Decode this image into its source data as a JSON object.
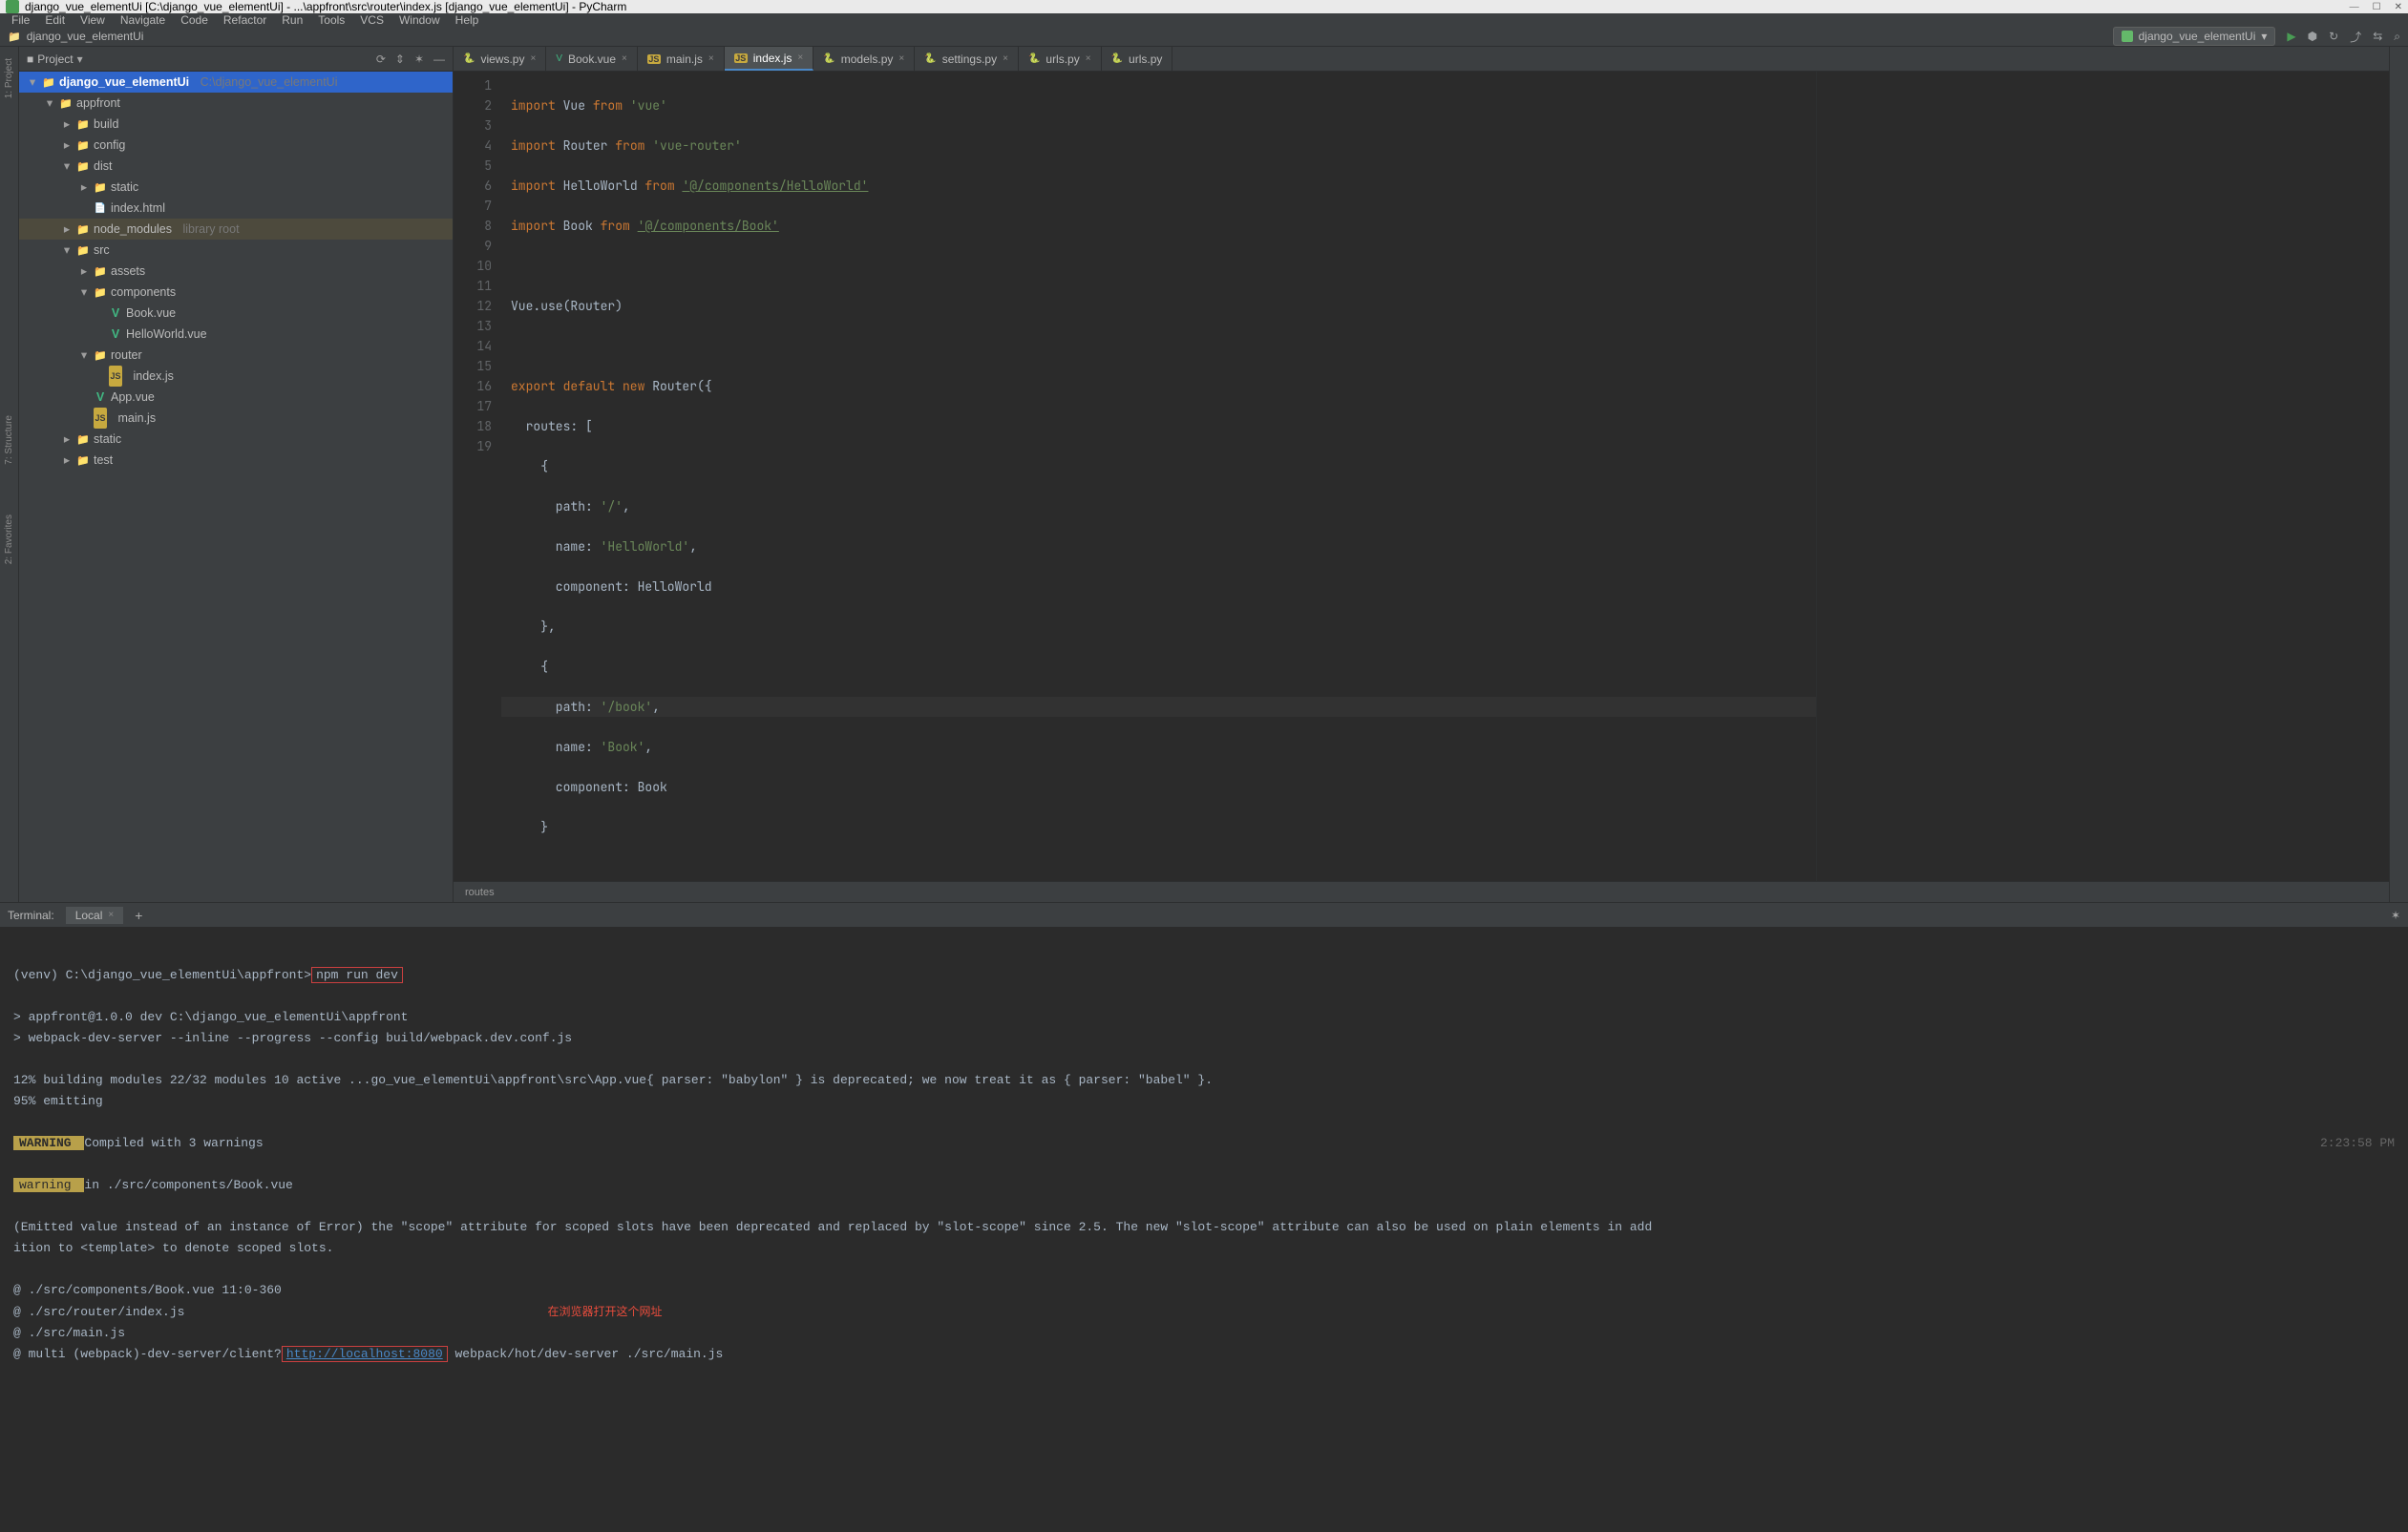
{
  "titlebar": {
    "text": "django_vue_elementUi [C:\\django_vue_elementUi] - ...\\appfront\\src\\router\\index.js [django_vue_elementUi] - PyCharm"
  },
  "window_controls": {
    "min": "—",
    "max": "☐",
    "close": "✕"
  },
  "menubar": [
    "File",
    "Edit",
    "View",
    "Navigate",
    "Code",
    "Refactor",
    "Run",
    "Tools",
    "VCS",
    "Window",
    "Help"
  ],
  "navbar": {
    "crumb": "django_vue_elementUi"
  },
  "run_config": {
    "label": "django_vue_elementUi",
    "chev": "▾"
  },
  "toolbar_icons": [
    "▶",
    "⬢",
    "↻",
    "⤴",
    "⇆",
    "⌕"
  ],
  "project_header": {
    "icon": "■",
    "title": "Project",
    "icons": [
      "⟳",
      "⇕",
      "✶",
      "—"
    ]
  },
  "left_tabs": {
    "project": "1: Project",
    "structure": "7: Structure",
    "favorites": "2: Favorites"
  },
  "tree": {
    "root": {
      "name": "django_vue_elementUi",
      "path": "C:\\django_vue_elementUi"
    },
    "appfront": "appfront",
    "build": "build",
    "config": "config",
    "dist": "dist",
    "static": "static",
    "index_html": "index.html",
    "node_modules": "node_modules",
    "library_root": "library root",
    "src": "src",
    "assets": "assets",
    "components": "components",
    "book_vue": "Book.vue",
    "hello_vue": "HelloWorld.vue",
    "router": "router",
    "index_js": "index.js",
    "app_vue": "App.vue",
    "main_js": "main.js",
    "static2": "static",
    "test": "test"
  },
  "tabs": [
    {
      "icon": "py",
      "label": "views.py"
    },
    {
      "icon": "vue",
      "label": "Book.vue"
    },
    {
      "icon": "js",
      "label": "main.js"
    },
    {
      "icon": "js",
      "label": "index.js",
      "active": true
    },
    {
      "icon": "py",
      "label": "models.py"
    },
    {
      "icon": "py",
      "label": "settings.py"
    },
    {
      "icon": "py",
      "label": "urls.py"
    },
    {
      "icon": "py",
      "label": "urls.py"
    }
  ],
  "gutter_lines": [
    "1",
    "2",
    "3",
    "4",
    "5",
    "6",
    "7",
    "8",
    "9",
    "10",
    "11",
    "12",
    "13",
    "14",
    "15",
    "16",
    "17",
    "18",
    "19"
  ],
  "code": {
    "l1a": "import",
    "l1b": " Vue ",
    "l1c": "from ",
    "l1d": "'vue'",
    "l2a": "import",
    "l2b": " Router ",
    "l2c": "from ",
    "l2d": "'vue-router'",
    "l3a": "import",
    "l3b": " HelloWorld ",
    "l3c": "from ",
    "l3d": "'@/components/HelloWorld'",
    "l4a": "import",
    "l4b": " Book ",
    "l4c": "from ",
    "l4d": "'@/components/Book'",
    "l6": "Vue.use(Router)",
    "l8a": "export default new",
    "l8b": " Router({",
    "l9": "  routes: [",
    "l10": "    {",
    "l11a": "      path: ",
    "l11b": "'/'",
    "l11c": ",",
    "l12a": "      name: ",
    "l12b": "'HelloWorld'",
    "l12c": ",",
    "l13": "      component: HelloWorld",
    "l14": "    },",
    "l15": "    {",
    "l16a": "      path: ",
    "l16b": "'/book'",
    "l16c": ",",
    "l17a": "      name: ",
    "l17b": "'Book'",
    "l17c": ",",
    "l18": "      component: Book",
    "l19": "    }"
  },
  "breadcrumb": "routes",
  "terminal_header": {
    "label": "Terminal:",
    "tab": "Local"
  },
  "terminal": {
    "l1_prompt": "(venv) C:\\django_vue_elementUi\\appfront>",
    "l1_cmd": "npm run dev",
    "l3": "> appfront@1.0.0 dev C:\\django_vue_elementUi\\appfront",
    "l4": "> webpack-dev-server --inline --progress --config build/webpack.dev.conf.js",
    "l6": " 12% building modules 22/32 modules 10 active ...go_vue_elementUi\\appfront\\src\\App.vue{ parser: \"babylon\" } is deprecated; we now treat it as { parser: \"babel\" }.",
    "l6b": " 95% emitting",
    "warn1": " WARNING ",
    "warn1_text": " Compiled with 3 warnings",
    "time": "2:23:58 PM",
    "warn2": " warning ",
    "warn2_text": " in ./src/components/Book.vue",
    "l10": "(Emitted value instead of an instance of Error) the \"scope\" attribute for scoped slots have been deprecated and replaced by \"slot-scope\" since 2.5. The new \"slot-scope\" attribute can also be used on plain elements in add",
    "l10b": "ition to <template> to denote scoped slots.",
    "l12": " @ ./src/components/Book.vue 11:0-360",
    "l13": " @ ./src/router/index.js",
    "l14": " @ ./src/main.js",
    "l15a": " @ multi (webpack)-dev-server/client?",
    "l15_link": "http://localhost:8080",
    "l15b": " webpack/hot/dev-server ./src/main.js",
    "redtext": "在浏览器打开这个网址"
  }
}
